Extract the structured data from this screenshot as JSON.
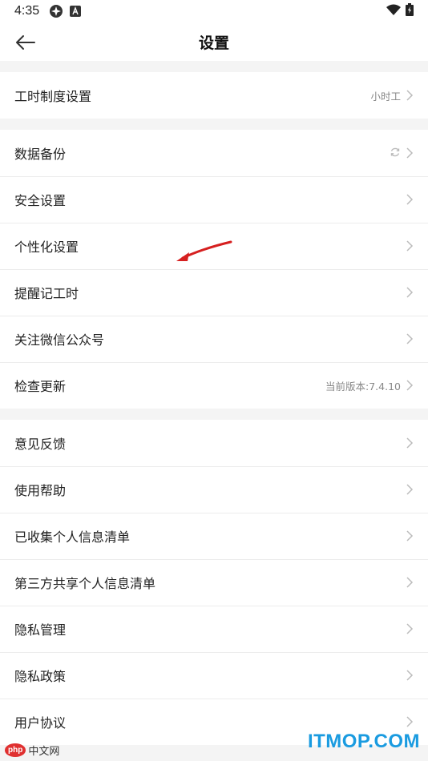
{
  "status": {
    "time": "4:35"
  },
  "header": {
    "title": "设置"
  },
  "group1": [
    {
      "label": "工时制度设置",
      "value": "小时工"
    }
  ],
  "group2": [
    {
      "label": "数据备份",
      "value": ""
    },
    {
      "label": "安全设置",
      "value": ""
    },
    {
      "label": "个性化设置",
      "value": ""
    },
    {
      "label": "提醒记工时",
      "value": ""
    },
    {
      "label": "关注微信公众号",
      "value": ""
    },
    {
      "label": "检查更新",
      "value": "当前版本:7.4.10"
    }
  ],
  "group3": [
    {
      "label": "意见反馈",
      "value": ""
    },
    {
      "label": "使用帮助",
      "value": ""
    },
    {
      "label": "已收集个人信息清单",
      "value": ""
    },
    {
      "label": "第三方共享个人信息清单",
      "value": ""
    },
    {
      "label": "隐私管理",
      "value": ""
    },
    {
      "label": "隐私政策",
      "value": ""
    },
    {
      "label": "用户协议",
      "value": ""
    }
  ],
  "watermarks": {
    "right": "ITMOP.COM",
    "left_badge": "php",
    "left_text": "中文网"
  },
  "colors": {
    "accent_watermark": "#1a9be0",
    "arrow": "#d62020"
  }
}
